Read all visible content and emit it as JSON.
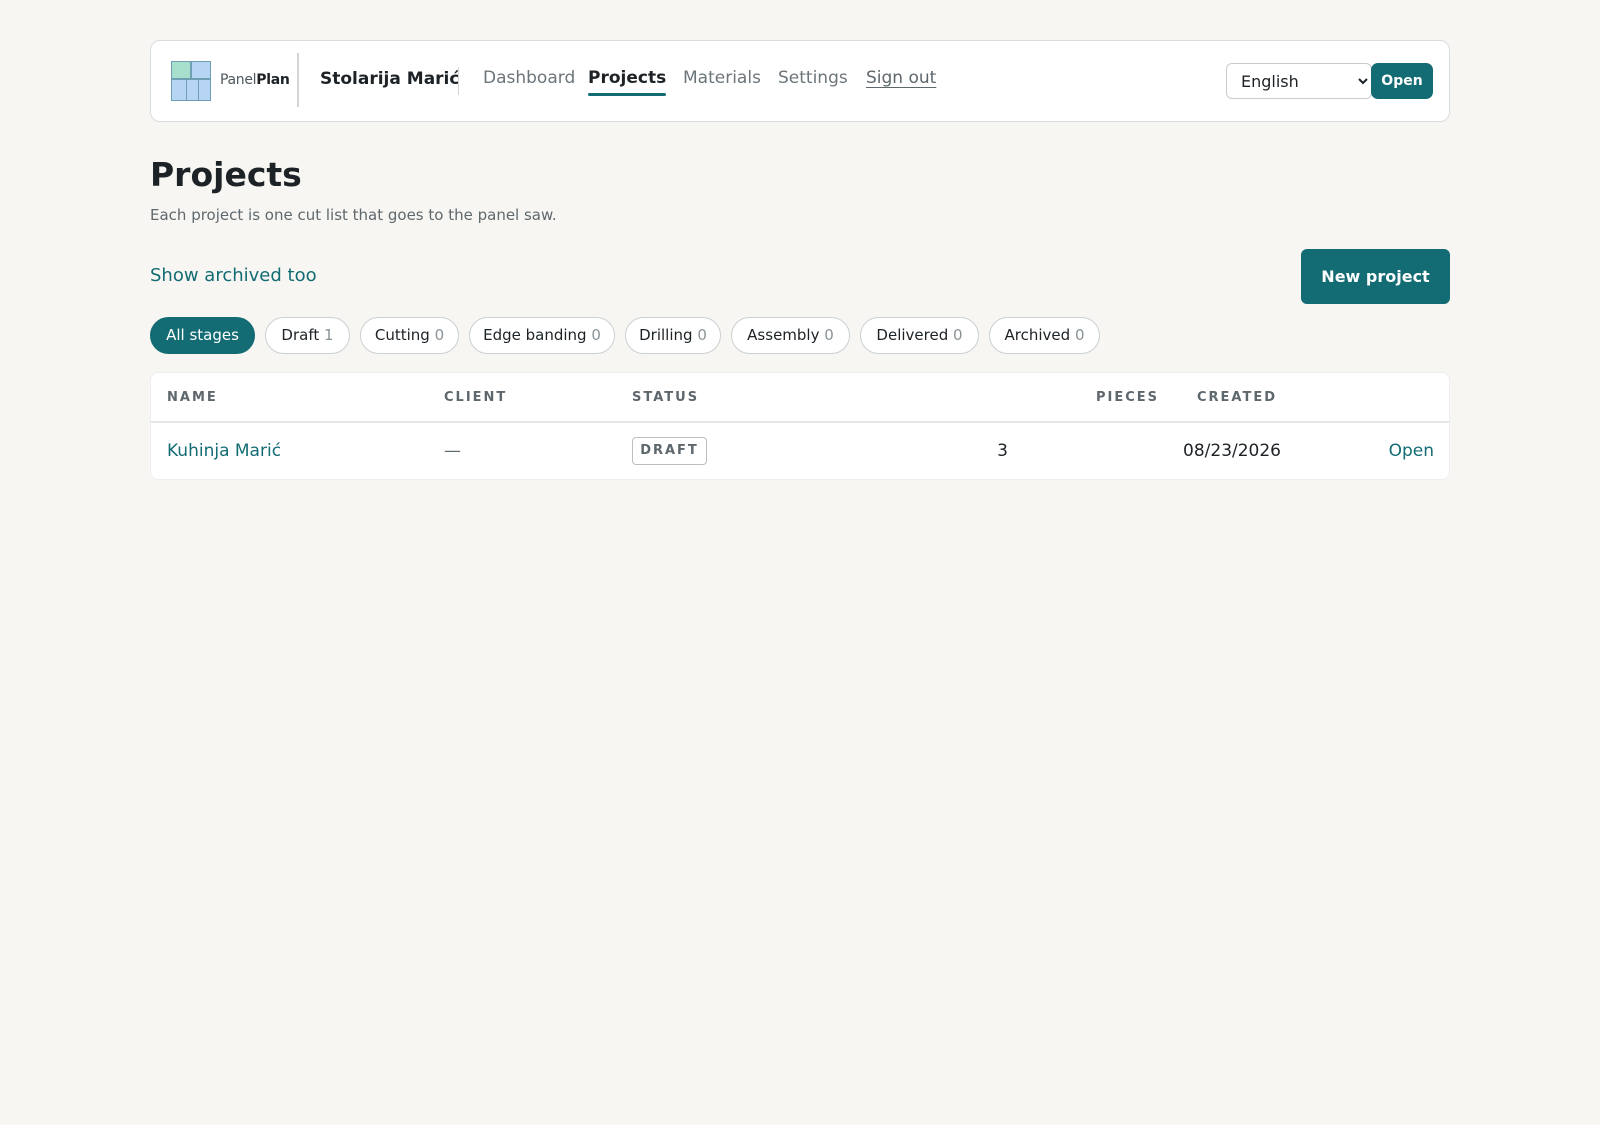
{
  "header": {
    "logo_text_light": "Panel",
    "logo_text_bold": "Plan",
    "shop_name": "Stolarija Marić",
    "nav": [
      {
        "label": "Dashboard"
      },
      {
        "label": "Projects"
      },
      {
        "label": "Materials"
      },
      {
        "label": "Settings"
      },
      {
        "label": "Sign out"
      }
    ],
    "language": {
      "selected": "English",
      "options": [
        "English"
      ]
    },
    "open_button": "Open",
    "accent_color": "#136b73"
  },
  "page": {
    "title": "Projects",
    "subtitle": "Each project is one cut list that goes to the panel saw.",
    "show_archived": "Show archived too",
    "new_project_button": "New project"
  },
  "filters": [
    {
      "label": "All stages",
      "count": ""
    },
    {
      "label": "Draft",
      "count": "1"
    },
    {
      "label": "Cutting",
      "count": "0"
    },
    {
      "label": "Edge banding",
      "count": "0"
    },
    {
      "label": "Drilling",
      "count": "0"
    },
    {
      "label": "Assembly",
      "count": "0"
    },
    {
      "label": "Delivered",
      "count": "0"
    },
    {
      "label": "Archived",
      "count": "0"
    }
  ],
  "table": {
    "columns": [
      "NAME",
      "CLIENT",
      "STATUS",
      "PIECES",
      "CREATED"
    ],
    "rows": [
      {
        "name": "Kuhinja Marić",
        "client": "—",
        "status": "DRAFT",
        "pieces": "3",
        "created": "08/23/2026",
        "action": "Open"
      }
    ]
  }
}
